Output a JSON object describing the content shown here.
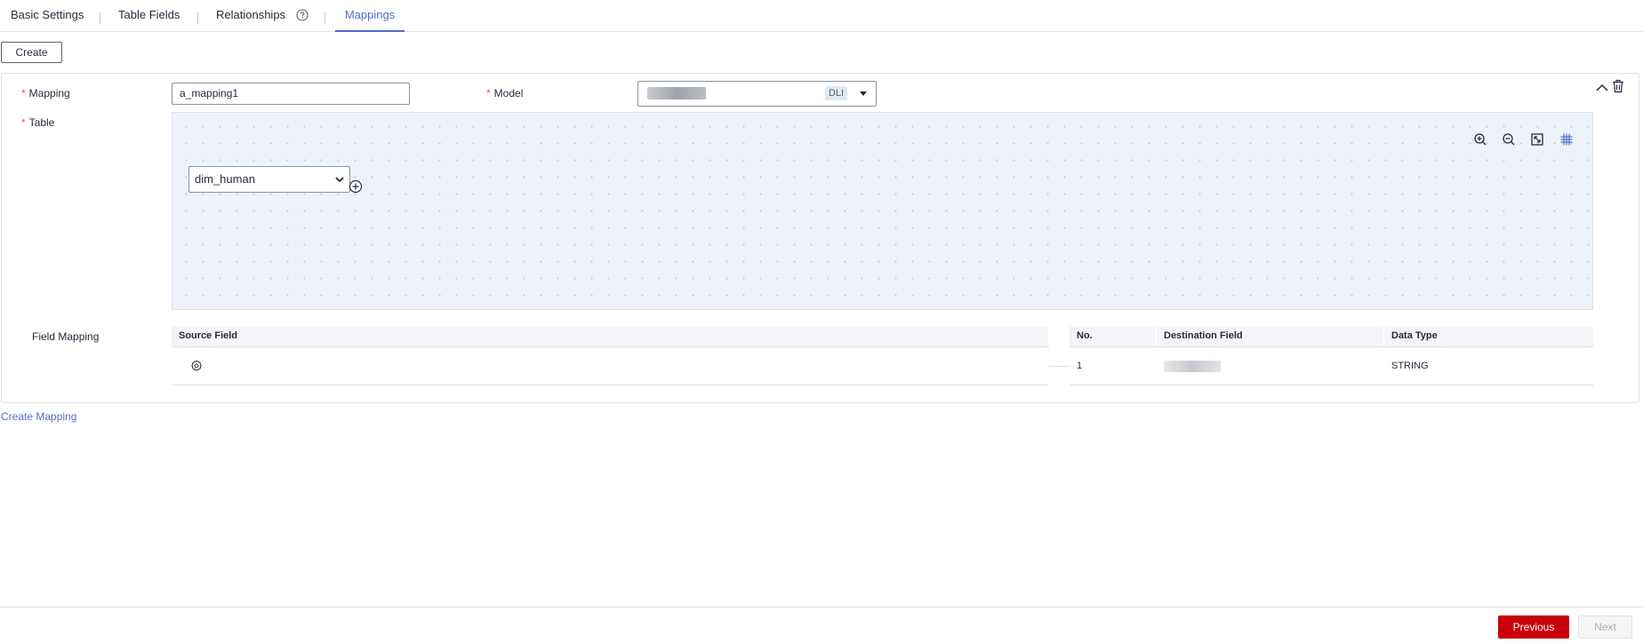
{
  "tabs": [
    {
      "label": "Basic Settings"
    },
    {
      "label": "Table Fields"
    },
    {
      "label": "Relationships"
    },
    {
      "label": "Mappings",
      "active": true
    }
  ],
  "toolbar": {
    "create_label": "Create"
  },
  "mapping_card": {
    "mapping_label": "Mapping",
    "mapping_value": "a_mapping1",
    "model_label": "Model",
    "model_tag": "DLI",
    "table_label": "Table",
    "table_selected": "dim_human",
    "field_mapping_label": "Field Mapping",
    "canvas_tools": [
      "zoom-in-icon",
      "zoom-out-icon",
      "fit-screen-icon",
      "grid-icon"
    ],
    "source_table": {
      "headers": [
        "Source Field"
      ]
    },
    "destination_table": {
      "headers": [
        "No.",
        "Destination Field",
        "Data Type"
      ],
      "rows": [
        {
          "no": "1",
          "data_type": "STRING"
        }
      ]
    }
  },
  "create_mapping_link": "Create Mapping",
  "footer": {
    "previous_label": "Previous",
    "next_label": "Next"
  },
  "colors": {
    "accent": "#526ecc",
    "primary_button": "#c7000b",
    "required": "#e65261",
    "canvas_bg": "#eef2fb"
  }
}
